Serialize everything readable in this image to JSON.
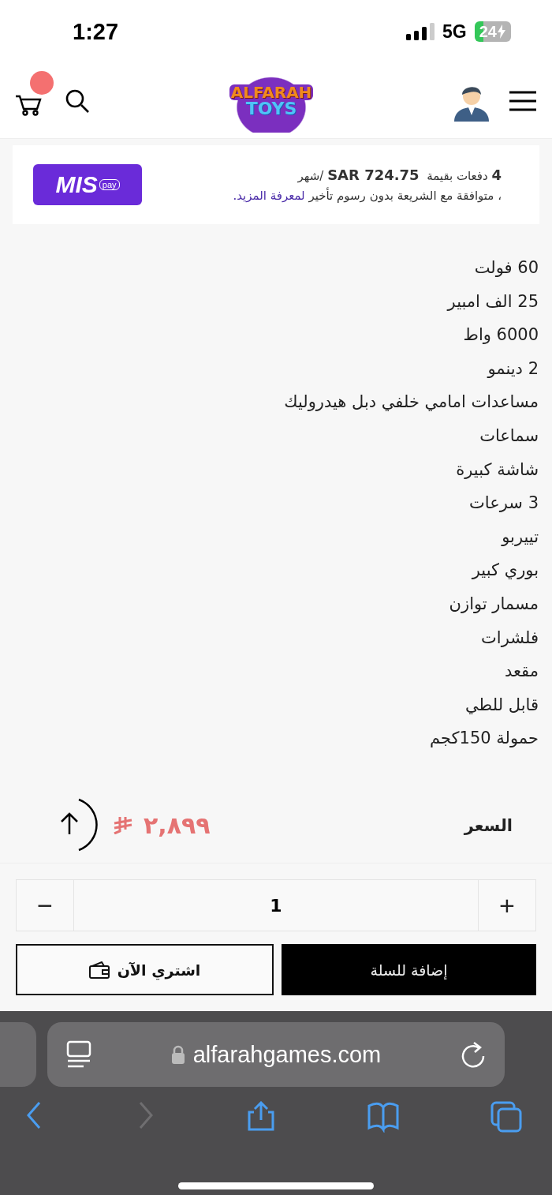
{
  "status_bar": {
    "time": "1:27",
    "network": "5G",
    "battery": "24"
  },
  "header": {
    "logo": [
      "ALFARAH",
      "TOYS"
    ],
    "cart_badge": true
  },
  "installments": {
    "line1_count": "4",
    "line1_text": "دفعات بقيمة",
    "amount": "SAR 724.75",
    "per": "/شهر",
    "line2": "، متوافقة مع الشريعة بدون رسوم تأخير",
    "link": "لمعرفة المزيد.",
    "logo": "MIS",
    "logo_sup": "pay"
  },
  "features": [
    "60 فولت",
    "25 الف امبير",
    "6000 واط",
    "2 دينمو",
    "مساعدات امامي خلفي دبل هيدروليك",
    "سماعات",
    "شاشة كبيرة",
    "3 سرعات",
    "تييربو",
    "بوري كبير",
    "مسمار توازن",
    "فلشرات",
    "مقعد",
    "قابل للطي",
    "حمولة 150كجم"
  ],
  "price": {
    "label": "السعر",
    "value": "٢,٨٩٩"
  },
  "quantity": {
    "minus": "−",
    "value": "1",
    "plus": "+"
  },
  "buttons": [
    {
      "kind": "primary",
      "label": "إضافة للسلة"
    },
    {
      "kind": "outline",
      "label": "اشتري الآن"
    }
  ],
  "browser": {
    "url": "alfarahgames.com",
    "nav": [
      {
        "kind": "back",
        "disabled": false
      },
      {
        "kind": "forward",
        "disabled": true
      },
      {
        "kind": "share",
        "disabled": false
      },
      {
        "kind": "bookmarks",
        "disabled": false
      },
      {
        "kind": "tabs",
        "disabled": false
      }
    ]
  }
}
